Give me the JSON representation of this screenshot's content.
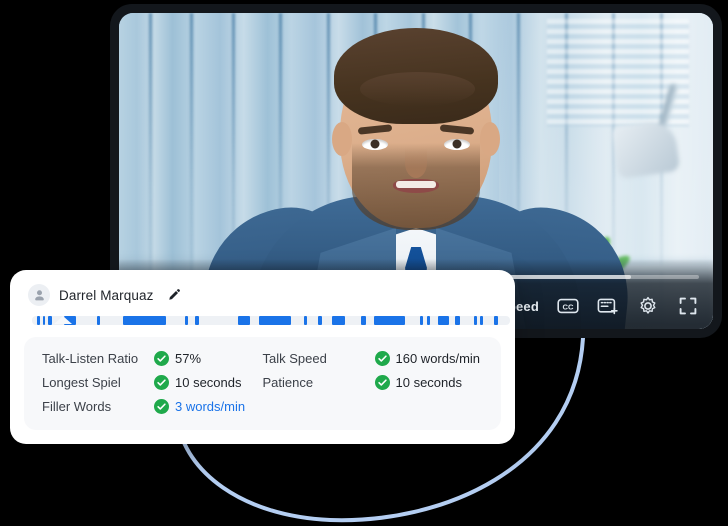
{
  "player": {
    "controls": {
      "speed_label": "Speed",
      "captions_icon": "closed-captions-icon",
      "clip_icon": "add-clip-icon",
      "settings_icon": "gear-icon",
      "fullscreen_icon": "fullscreen-icon",
      "progress_percent": 88
    },
    "video_description": "Man in a blue suit with white shirt and blue tie speaking on a video call in an office with window blinds, a plant and a desk lamp"
  },
  "insights": {
    "speaker": {
      "avatar_icon": "person-icon",
      "name": "Darrel Marquaz",
      "edit_icon": "pencil-icon"
    },
    "waveform": {
      "track_color": "#eef1f5",
      "segment_color": "#1a73e8",
      "segments": [
        {
          "x": 1.0,
          "w": 0.6
        },
        {
          "x": 2.2,
          "w": 0.6
        },
        {
          "x": 3.4,
          "w": 0.7
        },
        {
          "x": 6.6,
          "w": 2.6
        },
        {
          "x": 13.5,
          "w": 0.7
        },
        {
          "x": 19.0,
          "w": 9.0
        },
        {
          "x": 32.0,
          "w": 0.7
        },
        {
          "x": 34.2,
          "w": 0.7
        },
        {
          "x": 43.0,
          "w": 2.6
        },
        {
          "x": 47.5,
          "w": 6.6
        },
        {
          "x": 56.8,
          "w": 0.7
        },
        {
          "x": 59.8,
          "w": 0.8
        },
        {
          "x": 62.8,
          "w": 2.7
        },
        {
          "x": 68.8,
          "w": 1.1
        },
        {
          "x": 71.6,
          "w": 6.4
        },
        {
          "x": 81.2,
          "w": 0.6
        },
        {
          "x": 82.6,
          "w": 0.6
        },
        {
          "x": 85.0,
          "w": 2.3
        },
        {
          "x": 88.5,
          "w": 1.0
        },
        {
          "x": 92.4,
          "w": 0.6
        },
        {
          "x": 93.8,
          "w": 0.6
        },
        {
          "x": 96.6,
          "w": 0.9
        }
      ]
    },
    "metrics": [
      {
        "label": "Talk-Listen Ratio",
        "value": "57%",
        "status": "good",
        "link": false
      },
      {
        "label": "Talk Speed",
        "value": "160 words/min",
        "status": "good",
        "link": false
      },
      {
        "label": "Longest Spiel",
        "value": "10 seconds",
        "status": "good",
        "link": false
      },
      {
        "label": "Patience",
        "value": "10 seconds",
        "status": "good",
        "link": false
      },
      {
        "label": "Filler Words",
        "value": "3 words/min",
        "status": "good",
        "link": true
      }
    ],
    "colors": {
      "check_green": "#1fa94b",
      "accent_blue": "#1a73e8",
      "panel_bg": "#f7f8fa",
      "card_bg": "#ffffff"
    }
  },
  "decoration": {
    "arc_color": "#b4cef2",
    "arc_width": 4
  }
}
